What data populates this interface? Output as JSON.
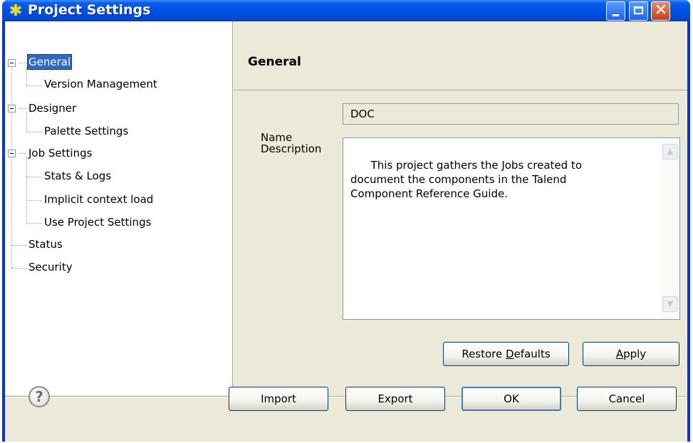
{
  "window": {
    "title": "Project Settings",
    "controls": {
      "minimize": "minimize",
      "maximize": "maximize",
      "close": "close"
    }
  },
  "tree": {
    "items": [
      {
        "label": "General",
        "selected": true
      },
      {
        "label": "Version Management"
      },
      {
        "label": "Designer"
      },
      {
        "label": "Palette Settings"
      },
      {
        "label": "Job Settings"
      },
      {
        "label": "Stats & Logs"
      },
      {
        "label": "Implicit context load"
      },
      {
        "label": "Use Project Settings"
      },
      {
        "label": "Status"
      },
      {
        "label": "Security"
      }
    ]
  },
  "panel": {
    "title": "General",
    "name_label": "Name",
    "name_value": "DOC",
    "description_label": "Description",
    "description_value": "This project gathers the Jobs created to\ndocument the components in the Talend\nComponent Reference Guide.",
    "restore_defaults_prefix": "Restore ",
    "restore_defaults_mnemonic": "D",
    "restore_defaults_suffix": "efaults",
    "apply_mnemonic": "A",
    "apply_suffix": "pply"
  },
  "footer": {
    "help_glyph": "?",
    "import_label": "Import",
    "export_label": "Export",
    "ok_label": "OK",
    "cancel_label": "Cancel"
  },
  "colors": {
    "title_bar": "#0052e6",
    "selection": "#316ac5",
    "dialog_bg": "#ece9d8"
  }
}
